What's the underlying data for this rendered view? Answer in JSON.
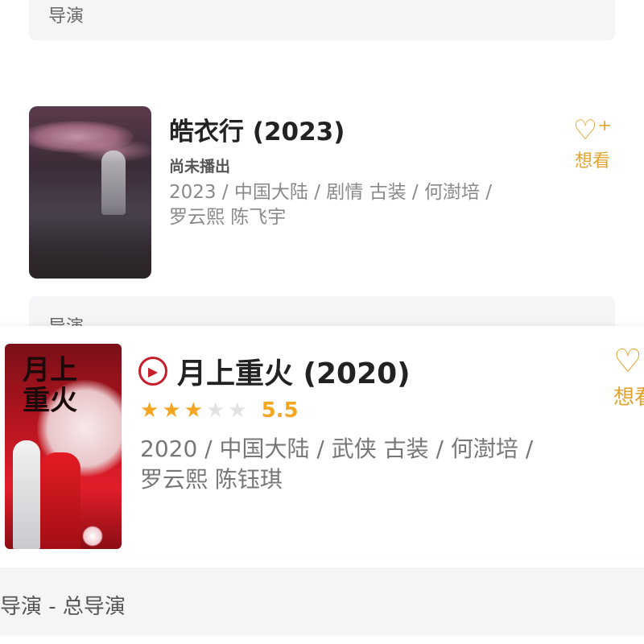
{
  "top_section": {
    "label": "导演"
  },
  "card1": {
    "title": "皓衣行 (2023)",
    "status": "尚未播出",
    "meta": "2023 / 中国大陆 / 剧情 古装 / 何澍培 / 罗云熙 陈飞宇",
    "want_label": "想看",
    "want_icon": "heart-plus-icon"
  },
  "middle_section": {
    "label": "导演"
  },
  "card2": {
    "title": "月上重火 (2020)",
    "play_icon": "play-circle-icon",
    "rating": {
      "stars_filled": 3,
      "stars_total": 5,
      "score": "5.5"
    },
    "meta": "2020 / 中国大陆 / 武侠 古装 / 何澍培 / 罗云熙 陈钰琪",
    "want_label": "想看",
    "want_icon": "heart-plus-icon",
    "poster_text": "月上重火"
  },
  "bottom_section": {
    "label": "导演 - 总导演"
  },
  "colors": {
    "accent": "#e3a42f",
    "star": "#f4a622",
    "play": "#c81e2a"
  }
}
